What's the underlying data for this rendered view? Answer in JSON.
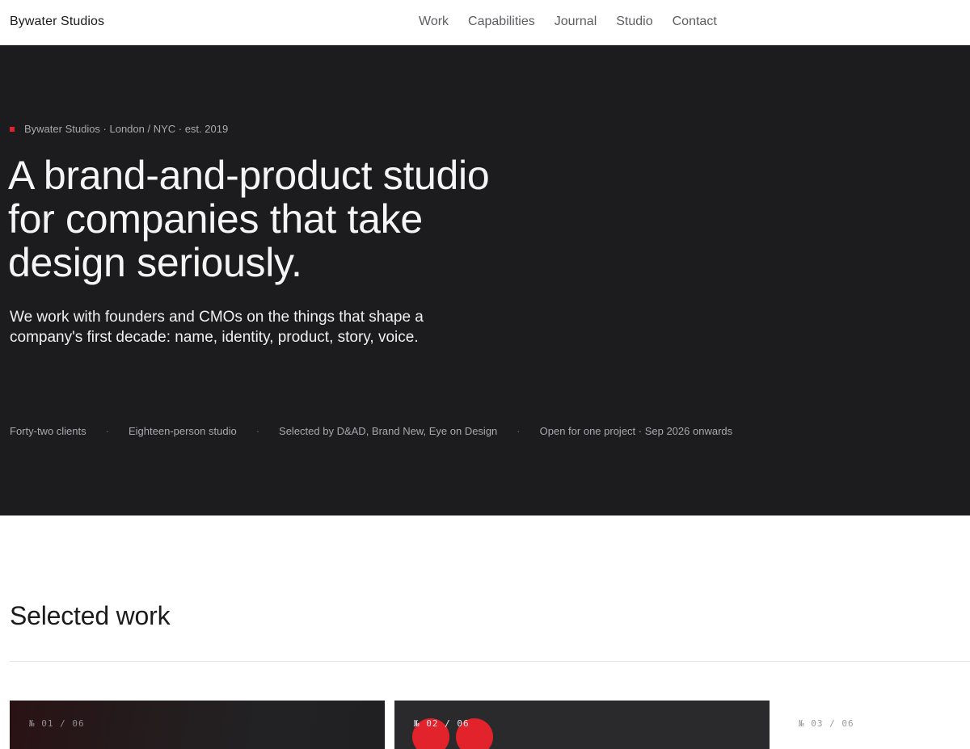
{
  "nav": {
    "brand": "Bywater Studios",
    "links": [
      "Work",
      "Capabilities",
      "Journal",
      "Studio",
      "Contact"
    ]
  },
  "hero": {
    "eyebrow": "Bywater Studios · London / NYC · est. 2019",
    "headline_lines": [
      "A brand-and-product studio",
      "for companies that take",
      "design seriously."
    ],
    "lede_lines": [
      "We work with founders and CMOs on the things that shape a",
      "company's first decade: name, identity, product, story, voice."
    ],
    "stats": [
      "Forty-two clients",
      "Eighteen-person studio",
      "Selected by D&AD, Brand New, Eye on Design",
      "Open for one project · Sep 2026 onwards"
    ],
    "separator": "·"
  },
  "work": {
    "title": "Selected work",
    "cards": [
      {
        "number": "№ 01 / 06"
      },
      {
        "number": "№ 02 / 06"
      },
      {
        "number": "№ 03 / 06"
      }
    ]
  },
  "colors": {
    "accent": "#e3232c",
    "hero_bg": "#1c1c1e",
    "text_dark": "#1b1b1c",
    "text_muted": "#a9a9ad"
  }
}
